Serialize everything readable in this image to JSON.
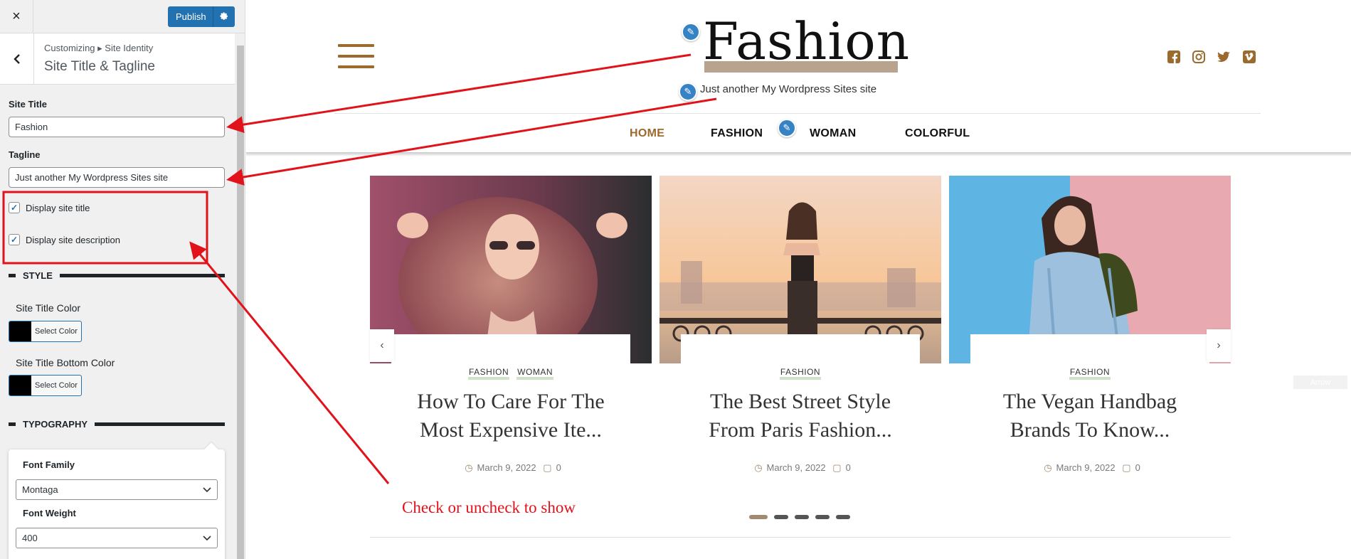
{
  "sidebar": {
    "close_label": "×",
    "publish_label": "Publish",
    "breadcrumb": "Customizing ▸ Site Identity",
    "section_title": "Site Title & Tagline",
    "site_title_label": "Site Title",
    "site_title_value": "Fashion",
    "tagline_label": "Tagline",
    "tagline_value": "Just another My Wordpress Sites site",
    "display_title_label": "Display site title",
    "display_description_label": "Display site description",
    "style_heading": "STYLE",
    "title_color_label": "Site Title Color",
    "title_bottom_color_label": "Site Title Bottom Color",
    "select_color_label": "Select Color",
    "typography_heading": "TYPOGRAPHY",
    "font_family_label": "Font Family",
    "font_family_value": "Montaga",
    "font_weight_label": "Font Weight",
    "font_weight_value": "400",
    "checkbox_states": [
      true,
      true
    ],
    "color_swatches": [
      "#000000",
      "#000000"
    ]
  },
  "preview": {
    "site_title": "Fashion",
    "tagline": "Just another My Wordpress Sites site",
    "social_icons": [
      "facebook-icon",
      "instagram-icon",
      "twitter-icon",
      "vimeo-icon"
    ],
    "nav": [
      "HOME",
      "FASHION",
      "WOMAN",
      "COLORFUL"
    ],
    "posts": [
      {
        "categories": [
          "FASHION",
          "WOMAN"
        ],
        "title_line1": "How To Care For The",
        "title_line2": "Most Expensive Ite...",
        "date": "March 9, 2022",
        "comments": "0"
      },
      {
        "categories": [
          "FASHION"
        ],
        "title_line1": "The Best Street Style",
        "title_line2": "From Paris Fashion...",
        "date": "March 9, 2022",
        "comments": "0"
      },
      {
        "categories": [
          "FASHION"
        ],
        "title_line1": "The Vegan Handbag",
        "title_line2": "Brands To Know...",
        "date": "March 9, 2022",
        "comments": "0"
      }
    ],
    "arrow_tag": "Arrow",
    "active_dot": 1,
    "dot_count": 5
  },
  "annotation": {
    "text": "Check or uncheck to show"
  },
  "colors": {
    "accent": "#9b6a2c",
    "publish": "#2271b1",
    "annotation_red": "#e1121a",
    "category_underline": "#cfe3c9"
  }
}
